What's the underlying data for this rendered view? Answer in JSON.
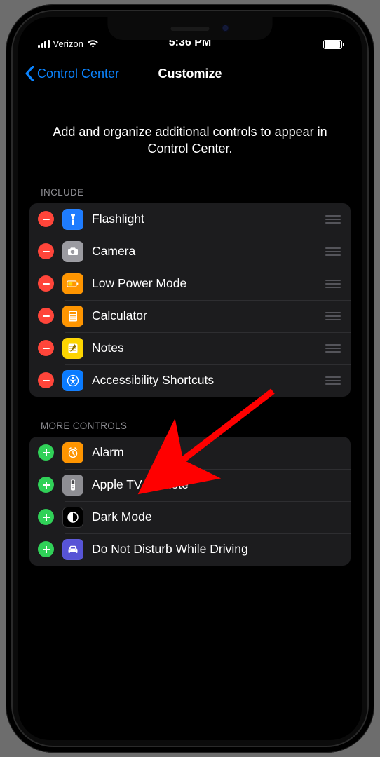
{
  "status": {
    "carrier": "Verizon",
    "time": "5:36 PM"
  },
  "nav": {
    "back_label": "Control Center",
    "title": "Customize"
  },
  "intro": "Add and organize additional controls to appear in Control Center.",
  "sections": {
    "include_header": "INCLUDE",
    "more_header": "MORE CONTROLS"
  },
  "include": [
    {
      "label": "Flashlight"
    },
    {
      "label": "Camera"
    },
    {
      "label": "Low Power Mode"
    },
    {
      "label": "Calculator"
    },
    {
      "label": "Notes"
    },
    {
      "label": "Accessibility Shortcuts"
    }
  ],
  "more": [
    {
      "label": "Alarm"
    },
    {
      "label": "Apple TV Remote"
    },
    {
      "label": "Dark Mode"
    },
    {
      "label": "Do Not Disturb While Driving"
    }
  ]
}
